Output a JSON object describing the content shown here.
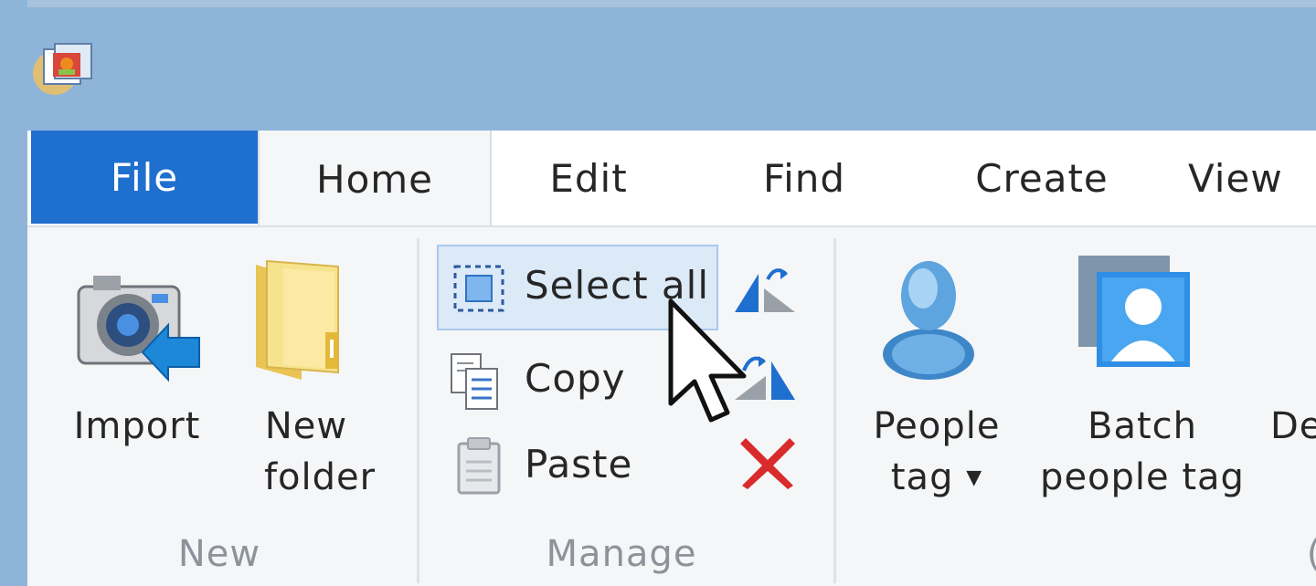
{
  "tabs": {
    "file": "File",
    "home": "Home",
    "edit": "Edit",
    "find": "Find",
    "create": "Create",
    "view": "View"
  },
  "ribbon": {
    "new_group": {
      "label": "New",
      "import": "Import",
      "new_folder_line1": "New",
      "new_folder_line2": "folder"
    },
    "manage_group": {
      "label": "Manage",
      "select_all": "Select all",
      "copy": "Copy",
      "paste": "Paste"
    },
    "people_group": {
      "people_tag_line1": "People",
      "people_tag_line2": "tag",
      "batch_line1": "Batch",
      "batch_line2": "people tag",
      "clipped_button_text": "De",
      "clipped_group_label": "("
    }
  },
  "colors": {
    "title_bar": "#8fb4d9",
    "file_tab": "#1f6fcf",
    "ribbon_bg": "#f5f6f7",
    "selection_highlight": "#dce9f7"
  },
  "icons": {
    "app": "photo-gallery-app-icon",
    "import": "camera-import-icon",
    "new_folder": "folder-icon",
    "select_all": "select-all-icon",
    "copy": "copy-icon",
    "paste": "paste-icon",
    "rotate_left": "rotate-left-icon",
    "rotate_right": "rotate-right-icon",
    "delete": "delete-icon",
    "people_tag": "person-icon",
    "batch_people_tag": "batch-person-icon",
    "cursor": "mouse-pointer-icon"
  }
}
